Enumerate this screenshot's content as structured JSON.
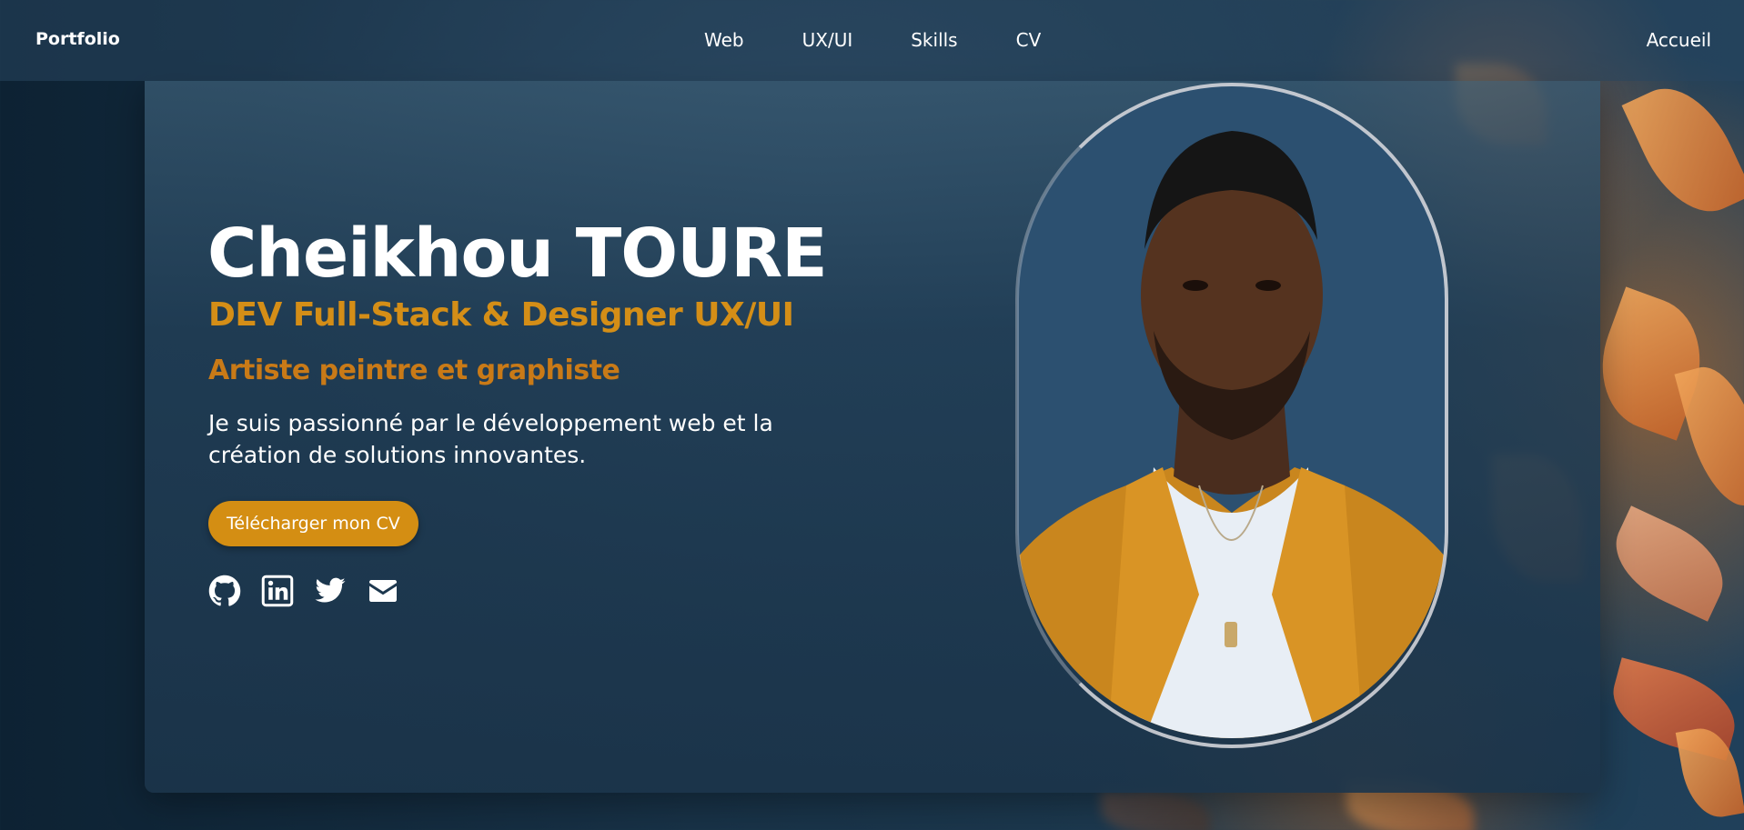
{
  "navbar": {
    "brand": "Portfolio",
    "links": [
      "Web",
      "UX/UI",
      "Skills",
      "CV"
    ],
    "right_link": "Accueil"
  },
  "hero": {
    "name": "Cheikhou TOURE",
    "role": "DEV Full-Stack & Designer UX/UI",
    "role_secondary": "Artiste peintre et graphiste",
    "intro": "Je suis passionné par le développement web et la création de solutions innovantes.",
    "cv_button": "Télécharger mon CV",
    "socials": [
      "github-icon",
      "linkedin-icon",
      "twitter-icon",
      "envelope-icon"
    ]
  },
  "colors": {
    "accent": "#d48e13",
    "role_text": "#d48e17",
    "background": "#1d3a50"
  }
}
